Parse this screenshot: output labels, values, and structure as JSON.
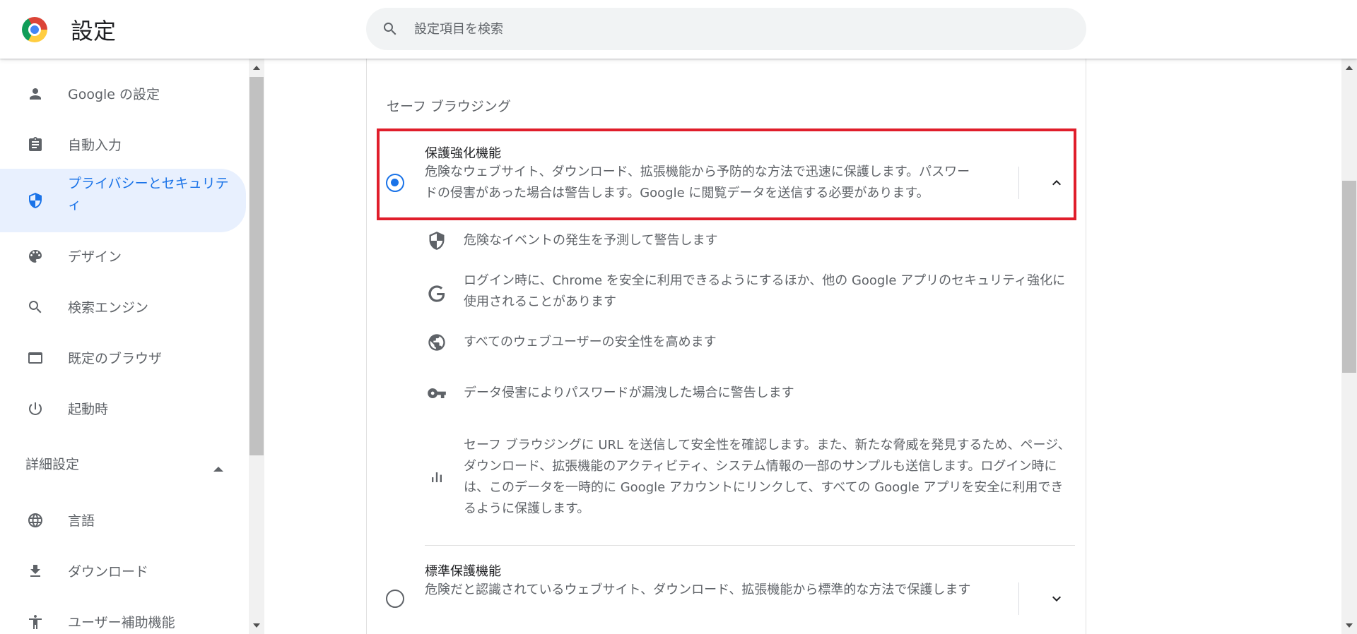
{
  "header": {
    "title": "設定",
    "search_placeholder": "設定項目を検索"
  },
  "sidebar": {
    "items": [
      {
        "label": "Google の設定",
        "icon": "person-icon"
      },
      {
        "label": "自動入力",
        "icon": "clipboard-icon"
      },
      {
        "label": "プライバシーとセキュリティ",
        "icon": "shield-icon",
        "active": true
      },
      {
        "label": "デザイン",
        "icon": "palette-icon"
      },
      {
        "label": "検索エンジン",
        "icon": "search-icon"
      },
      {
        "label": "既定のブラウザ",
        "icon": "browser-window-icon"
      },
      {
        "label": "起動時",
        "icon": "power-icon"
      }
    ],
    "advanced_label": "詳細設定",
    "advanced_items": [
      {
        "label": "言語",
        "icon": "globe-icon"
      },
      {
        "label": "ダウンロード",
        "icon": "download-icon"
      },
      {
        "label": "ユーザー補助機能",
        "icon": "accessibility-icon"
      }
    ]
  },
  "main": {
    "section_title": "セーフ ブラウジング",
    "enhanced": {
      "title": "保護強化機能",
      "description": "危険なウェブサイト、ダウンロード、拡張機能から予防的な方法で迅速に保護します。パスワードの侵害があった場合は警告します。Google に閲覧データを送信する必要があります。",
      "selected": true
    },
    "features": [
      {
        "icon": "shield-half-icon",
        "text": "危険なイベントの発生を予測して警告します"
      },
      {
        "icon": "google-g-icon",
        "text": "ログイン時に、Chrome を安全に利用できるようにするほか、他の Google アプリのセキュリティ強化に使用されることがあります"
      },
      {
        "icon": "globe-filled-icon",
        "text": "すべてのウェブユーザーの安全性を高めます"
      },
      {
        "icon": "key-icon",
        "text": "データ侵害によりパスワードが漏洩した場合に警告します"
      },
      {
        "icon": "bar-chart-icon",
        "text": "セーフ ブラウジングに URL を送信して安全性を確認します。また、新たな脅威を発見するため、ページ、ダウンロード、拡張機能のアクティビティ、システム情報の一部のサンプルも送信します。ログイン時には、このデータを一時的に Google アカウントにリンクして、すべての Google アプリを安全に利用できるように保護します。"
      }
    ],
    "standard": {
      "title": "標準保護機能",
      "description": "危険だと認識されているウェブサイト、ダウンロード、拡張機能から標準的な方法で保護します",
      "selected": false
    }
  },
  "colors": {
    "accent": "#1a73e8",
    "highlight_border": "#e01e2b",
    "active_nav_bg": "#e8f0fe"
  }
}
